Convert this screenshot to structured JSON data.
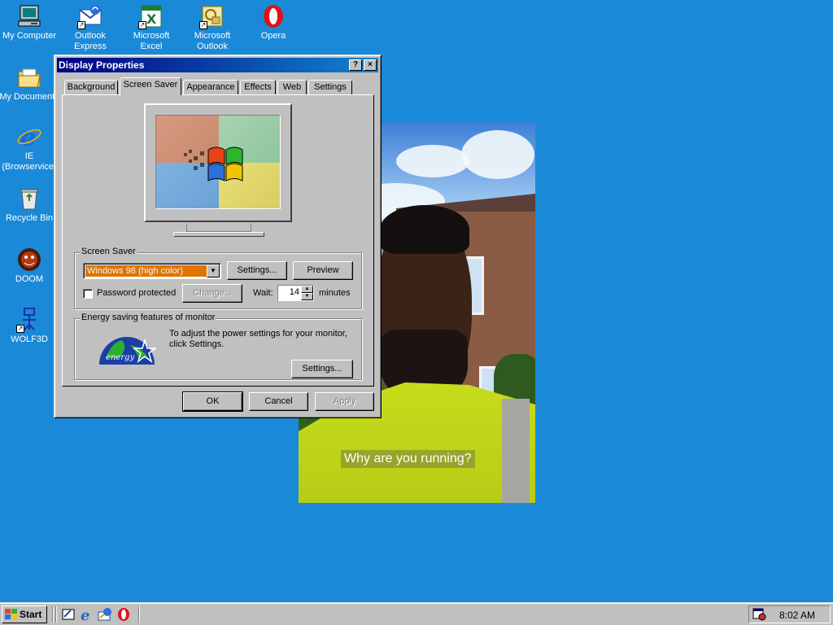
{
  "desktop": {
    "background_color": "#1a8ad8",
    "icons": [
      {
        "label": "My Computer",
        "icon": "computer-icon"
      },
      {
        "label": "Outlook Express",
        "icon": "outlook-express-icon"
      },
      {
        "label": "Microsoft Excel",
        "icon": "excel-icon"
      },
      {
        "label": "Microsoft Outlook",
        "icon": "outlook-icon"
      },
      {
        "label": "Opera",
        "icon": "opera-icon"
      },
      {
        "label": "My Documents",
        "icon": "folder-icon"
      },
      {
        "label": "IE (Browservice)",
        "icon": "internet-explorer-icon"
      },
      {
        "label": "Recycle Bin",
        "icon": "recycle-bin-icon"
      },
      {
        "label": "DOOM",
        "icon": "doom-icon"
      },
      {
        "label": "WOLF3D",
        "icon": "wolf3d-icon"
      }
    ]
  },
  "video": {
    "caption": "Why are you running?"
  },
  "dialog": {
    "title": "Display Properties",
    "help_button": "?",
    "close_button": "×",
    "tabs": [
      {
        "label": "Background",
        "active": false
      },
      {
        "label": "Screen Saver",
        "active": true
      },
      {
        "label": "Appearance",
        "active": false
      },
      {
        "label": "Effects",
        "active": false
      },
      {
        "label": "Web",
        "active": false
      },
      {
        "label": "Settings",
        "active": false
      }
    ],
    "screen_saver": {
      "group_label": "Screen Saver",
      "selected": "Windows 98 (high color)",
      "settings_button": "Settings...",
      "preview_button": "Preview",
      "password_label": "Password protected",
      "password_checked": false,
      "change_button": "Change...",
      "wait_label": "Wait:",
      "wait_value": "14",
      "minutes_label": "minutes"
    },
    "energy": {
      "group_label": "Energy saving features of monitor",
      "description": "To adjust the power settings for your monitor, click Settings.",
      "settings_button": "Settings..."
    },
    "ok_button": "OK",
    "cancel_button": "Cancel",
    "apply_button": "Apply"
  },
  "taskbar": {
    "start_label": "Start",
    "quick_launch": [
      "show-desktop-icon",
      "internet-explorer-icon",
      "outlook-express-icon",
      "opera-icon"
    ],
    "clock": "8:02 AM"
  }
}
